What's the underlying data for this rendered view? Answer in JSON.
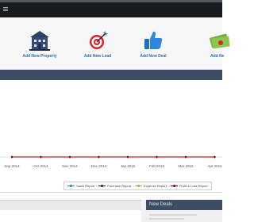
{
  "quick_actions": [
    {
      "label": "Add New Property",
      "icon": "building-icon"
    },
    {
      "label": "Add New Lead",
      "icon": "target-dart-icon"
    },
    {
      "label": "Add New Deal",
      "icon": "thumbs-up-icon"
    },
    {
      "label": "Add Ne",
      "icon": "money-icon"
    }
  ],
  "chart_data": {
    "type": "line",
    "categories": [
      "Sep 2014",
      "Oct 2014",
      "Nov 2014",
      "Dec 2014",
      "Jan 2015",
      "Feb 2015",
      "Mar 2015",
      "Apr 2015"
    ],
    "series": [
      {
        "name": "Sales Report",
        "color": "#2f7ed8",
        "values": [
          0,
          0,
          0,
          0,
          0,
          0,
          0,
          0
        ]
      },
      {
        "name": "Purchase Report",
        "color": "#0d233a",
        "values": [
          0,
          0,
          0,
          0,
          0,
          0,
          0,
          0
        ]
      },
      {
        "name": "Expense Report",
        "color": "#8bbc21",
        "values": [
          0,
          0,
          0,
          0,
          0,
          0,
          0,
          0
        ]
      },
      {
        "name": "Profit & Loss Report",
        "color": "#910000",
        "values": [
          0,
          0,
          0,
          0,
          0,
          0,
          0,
          0
        ]
      }
    ],
    "legend": "bottom-center",
    "grid": false
  },
  "new_deals": {
    "title": "New Deals"
  },
  "colors": {
    "header": "#3c4d66",
    "link": "#2a6db8",
    "topbar": "#181c1e"
  }
}
